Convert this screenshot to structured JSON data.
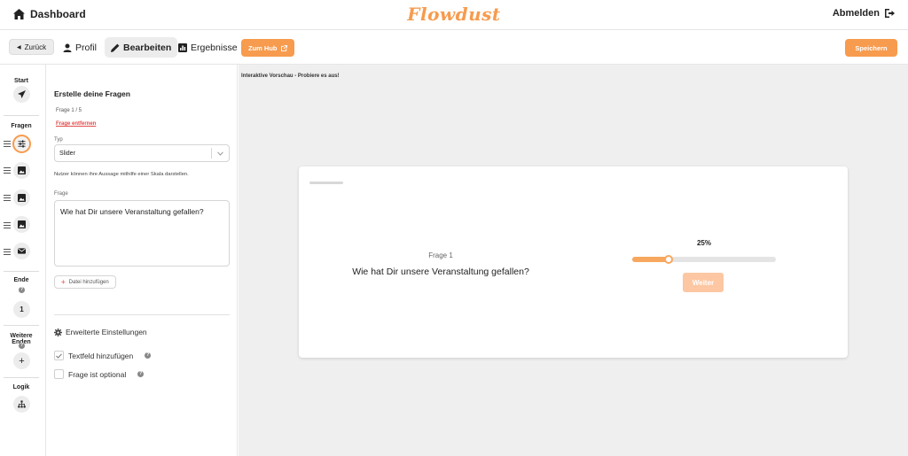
{
  "header": {
    "dashboard_label": "Dashboard",
    "logo_text": "Flowdust",
    "logout_label": "Abmelden"
  },
  "toolbar": {
    "back_label": "Zurück",
    "tabs": [
      {
        "label": "Profil",
        "icon": "user-icon",
        "active": false
      },
      {
        "label": "Bearbeiten",
        "icon": "pencil-icon",
        "active": true
      },
      {
        "label": "Ergebnisse",
        "icon": "chart-icon",
        "active": false
      }
    ],
    "hub_label": "Zum Hub",
    "save_label": "Speichern"
  },
  "rail": {
    "start_label": "Start",
    "questions_label": "Fragen",
    "end_label": "Ende",
    "end_number": "1",
    "more_ends_label": "Weitere Enden",
    "add_symbol": "+",
    "logic_label": "Logik",
    "question_icons": [
      "sliders-icon",
      "image-icon",
      "image-icon",
      "image-icon",
      "envelope-icon"
    ]
  },
  "editor": {
    "title": "Erstelle deine Fragen",
    "count": "Frage 1 / 5",
    "remove_label": "Frage entfernen",
    "type_label": "Typ",
    "type_value": "Slider",
    "help_text": "Nutzer können ihre Aussage mithilfe einer Skala darstellen.",
    "question_label": "Frage",
    "question_value": "Wie hat Dir unsere Veranstaltung gefallen?",
    "add_file_label": "Datei hinzufügen",
    "advanced_label": "Erweiterte Einstellungen",
    "options": [
      {
        "label": "Textfeld hinzufügen",
        "checked": true
      },
      {
        "label": "Frage ist optional",
        "checked": false
      }
    ]
  },
  "preview": {
    "title": "Interaktive Vorschau - Probiere es aus!",
    "question_number": "Frage 1",
    "question_text": "Wie hat Dir unsere Veranstaltung gefallen?",
    "slider_percent": "25%",
    "slider_value": 0.25,
    "next_label": "Weiter"
  },
  "colors": {
    "accent": "#f79b4e",
    "accent_light": "#fcc7a2",
    "danger": "#e24b4b"
  }
}
